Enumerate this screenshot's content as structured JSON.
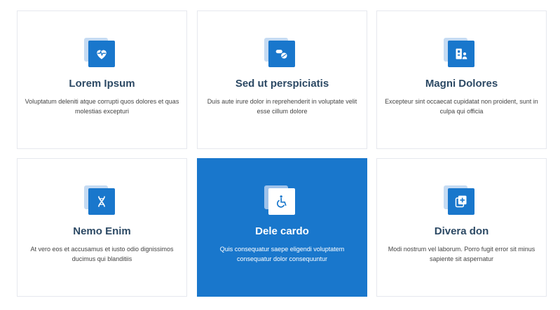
{
  "cards": [
    {
      "icon": "heartbeat-icon",
      "title": "Lorem Ipsum",
      "description": "Voluptatum deleniti atque corrupti quos dolores et quas molestias excepturi"
    },
    {
      "icon": "pills-icon",
      "title": "Sed ut perspiciatis",
      "description": "Duis aute irure dolor in reprehenderit in voluptate velit esse cillum dolore"
    },
    {
      "icon": "hospital-user-icon",
      "title": "Magni Dolores",
      "description": "Excepteur sint occaecat cupidatat non proident, sunt in culpa qui officia"
    },
    {
      "icon": "dna-icon",
      "title": "Nemo Enim",
      "description": "At vero eos et accusamus et iusto odio dignissimos ducimus qui blanditiis"
    },
    {
      "icon": "wheelchair-icon",
      "title": "Dele cardo",
      "description": "Quis consequatur saepe eligendi voluptatem consequatur dolor consequuntur"
    },
    {
      "icon": "notes-medical-icon",
      "title": "Divera don",
      "description": "Modi nostrum vel laborum. Porro fugit error sit minus sapiente sit aspernatur"
    }
  ],
  "colors": {
    "accent": "#1977cc",
    "title": "#2c4964",
    "text": "#444444"
  }
}
